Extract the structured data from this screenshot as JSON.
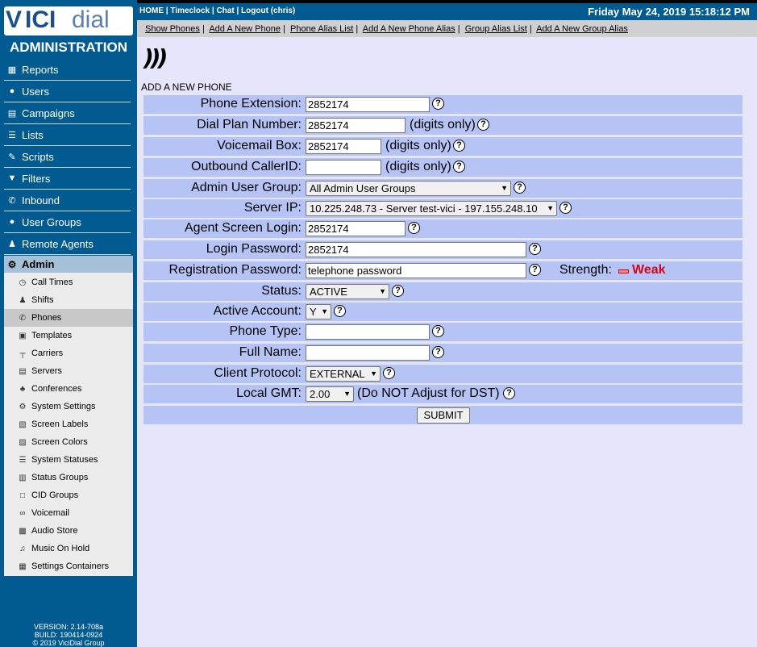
{
  "logo": {
    "v": "V",
    "vici": "ICI",
    "dial": "dial"
  },
  "sidebar": {
    "title": "ADMINISTRATION",
    "items": [
      {
        "label": "Reports",
        "icon": "bar-chart-icon",
        "glyph": "▦"
      },
      {
        "label": "Users",
        "icon": "users-icon",
        "glyph": "●"
      },
      {
        "label": "Campaigns",
        "icon": "list-box-icon",
        "glyph": "▤"
      },
      {
        "label": "Lists",
        "icon": "list-icon",
        "glyph": "☰"
      },
      {
        "label": "Scripts",
        "icon": "edit-icon",
        "glyph": "✎"
      },
      {
        "label": "Filters",
        "icon": "filter-icon",
        "glyph": "▼"
      },
      {
        "label": "Inbound",
        "icon": "phone-icon",
        "glyph": "✆"
      },
      {
        "label": "User Groups",
        "icon": "users-icon",
        "glyph": "●"
      },
      {
        "label": "Remote Agents",
        "icon": "remote-agent-icon",
        "glyph": "♟"
      }
    ],
    "admin_label": "Admin",
    "admin_glyph": "⚙",
    "submenu": [
      {
        "label": "Call Times",
        "icon": "clock-icon",
        "glyph": "◷"
      },
      {
        "label": "Shifts",
        "icon": "people-icon",
        "glyph": "♟"
      },
      {
        "label": "Phones",
        "icon": "phone-icon",
        "glyph": "✆"
      },
      {
        "label": "Templates",
        "icon": "template-icon",
        "glyph": "▣"
      },
      {
        "label": "Carriers",
        "icon": "carrier-icon",
        "glyph": "┬"
      },
      {
        "label": "Servers",
        "icon": "server-icon",
        "glyph": "▤"
      },
      {
        "label": "Conferences",
        "icon": "conference-icon",
        "glyph": "♣"
      },
      {
        "label": "System Settings",
        "icon": "gears-icon",
        "glyph": "⚙"
      },
      {
        "label": "Screen Labels",
        "icon": "label-icon",
        "glyph": "▧"
      },
      {
        "label": "Screen Colors",
        "icon": "palette-icon",
        "glyph": "▨"
      },
      {
        "label": "System Statuses",
        "icon": "list-icon",
        "glyph": "☰"
      },
      {
        "label": "Status Groups",
        "icon": "group-icon",
        "glyph": "▥"
      },
      {
        "label": "CID Groups",
        "icon": "box-icon",
        "glyph": "□"
      },
      {
        "label": "Voicemail",
        "icon": "voicemail-icon",
        "glyph": "∞"
      },
      {
        "label": "Audio Store",
        "icon": "audio-icon",
        "glyph": "▩"
      },
      {
        "label": "Music On Hold",
        "icon": "music-icon",
        "glyph": "♫"
      },
      {
        "label": "Settings Containers",
        "icon": "container-icon",
        "glyph": "▦"
      }
    ],
    "active_submenu": "Phones",
    "version": [
      "VERSION: 2.14-708a",
      "BUILD: 190414-0924",
      "© 2019 ViciDial Group"
    ]
  },
  "topbar": {
    "home": "HOME",
    "timeclock": "Timeclock",
    "chat": "Chat",
    "logout": "Logout (chris)",
    "separator": " | ",
    "datetime": "Friday May 24, 2019 15:18:12 PM"
  },
  "subnav": [
    "Show Phones",
    "Add A New Phone",
    "Phone Alias List",
    "Add A New Phone Alias",
    "Group Alias List",
    "Add A New Group Alias"
  ],
  "page": {
    "phone_glyph": ")))",
    "title": "ADD A NEW PHONE"
  },
  "form": {
    "rows": [
      {
        "label": "Phone Extension:",
        "type": "input",
        "value": "2852174",
        "hint": ""
      },
      {
        "label": "Dial Plan Number:",
        "type": "input",
        "value": "2852174",
        "hint": "(digits only)"
      },
      {
        "label": "Voicemail Box:",
        "type": "input",
        "value": "2852174",
        "hint": "(digits only)"
      },
      {
        "label": "Outbound CallerID:",
        "type": "input",
        "value": "",
        "hint": "(digits only)"
      },
      {
        "label": "Admin User Group:",
        "type": "select",
        "value": "All Admin User Groups",
        "hint": ""
      },
      {
        "label": "Server IP:",
        "type": "select",
        "value": "10.225.248.73 - Server test-vici - 197.155.248.10",
        "hint": ""
      },
      {
        "label": "Agent Screen Login:",
        "type": "input",
        "value": "2852174",
        "hint": ""
      },
      {
        "label": "Login Password:",
        "type": "input",
        "value": "2852174",
        "hint": ""
      },
      {
        "label": "Registration Password:",
        "type": "input",
        "value": "telephone password",
        "hint": ""
      },
      {
        "label": "Status:",
        "type": "select",
        "value": "ACTIVE",
        "hint": ""
      },
      {
        "label": "Active Account:",
        "type": "select",
        "value": "Y",
        "hint": ""
      },
      {
        "label": "Phone Type:",
        "type": "input",
        "value": "",
        "hint": ""
      },
      {
        "label": "Full Name:",
        "type": "input",
        "value": "",
        "hint": ""
      },
      {
        "label": "Client Protocol:",
        "type": "select",
        "value": "EXTERNAL",
        "hint": ""
      },
      {
        "label": "Local GMT:",
        "type": "select",
        "value": "2.00",
        "hint": "(Do NOT Adjust for DST)"
      }
    ],
    "strength_label": "Strength:",
    "strength_value": "Weak",
    "help_glyph": "?",
    "select_arrow": "▼",
    "submit_label": "SUBMIT"
  }
}
